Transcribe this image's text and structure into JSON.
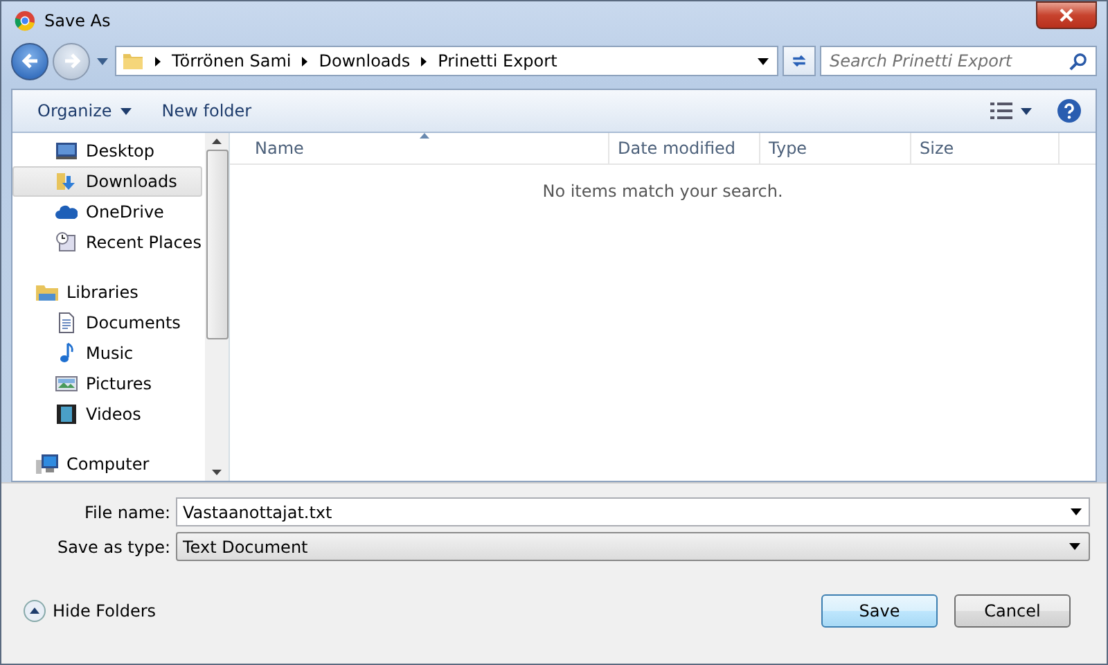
{
  "window": {
    "title": "Save As"
  },
  "address": {
    "segments": [
      "Törrönen Sami",
      "Downloads",
      "Prinetti Export"
    ]
  },
  "search": {
    "placeholder": "Search Prinetti Export"
  },
  "toolbar": {
    "organize": "Organize",
    "new_folder": "New folder"
  },
  "navigation": {
    "favorites": [
      {
        "label": "Desktop",
        "selected": false
      },
      {
        "label": "Downloads",
        "selected": true
      },
      {
        "label": "OneDrive",
        "selected": false
      },
      {
        "label": "Recent Places",
        "selected": false
      }
    ],
    "libraries": {
      "label": "Libraries",
      "children": [
        {
          "label": "Documents",
          "selected": false
        },
        {
          "label": "Music",
          "selected": false
        },
        {
          "label": "Pictures",
          "selected": false
        },
        {
          "label": "Videos",
          "selected": false
        }
      ]
    },
    "computer": {
      "label": "Computer"
    }
  },
  "file_list": {
    "columns": [
      {
        "label": "Name",
        "sorted": true
      },
      {
        "label": "Date modified",
        "sorted": false
      },
      {
        "label": "Type",
        "sorted": false
      },
      {
        "label": "Size",
        "sorted": false
      }
    ],
    "empty_message": "No items match your search."
  },
  "file_name": {
    "label": "File name:",
    "value": "Vastaanottajat.txt"
  },
  "save_as_type": {
    "label": "Save as type:",
    "value": "Text Document"
  },
  "hide_folders": "Hide Folders",
  "buttons": [
    {
      "label": "Save",
      "default": true
    },
    {
      "label": "Cancel",
      "default": false
    }
  ]
}
